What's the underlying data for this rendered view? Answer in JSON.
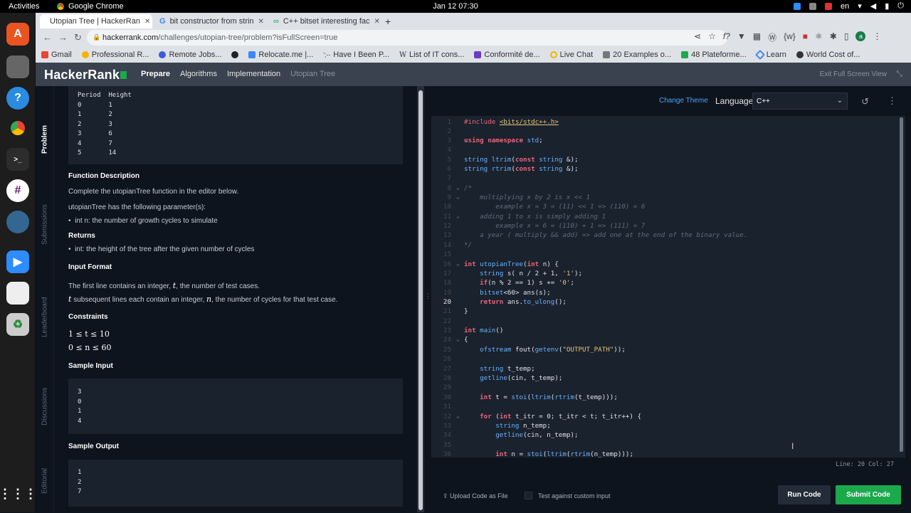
{
  "os": {
    "activities": "Activities",
    "app_name": "Google Chrome",
    "clock": "Jan 12  07:30",
    "lang": "en"
  },
  "browser": {
    "tabs": [
      {
        "label": "Utopian Tree | HackerRan"
      },
      {
        "label": "bit constructor from strin"
      },
      {
        "label": "C++ bitset interesting fac"
      }
    ],
    "url_host": "hackerrank.com",
    "url_path": "/challenges/utopian-tree/problem?isFullScreen=true",
    "bookmarks": [
      {
        "label": "Gmail",
        "color": "#ea4335"
      },
      {
        "label": "Professional R...",
        "color": "#f4b400"
      },
      {
        "label": "Remote Jobs...",
        "color": "#3b5bdb"
      },
      {
        "label": "",
        "color": "#222222"
      },
      {
        "label": "Relocate.me |...",
        "color": "#4285f4"
      },
      {
        "label": "Have I Been P...",
        "color": "#555555"
      },
      {
        "label": "List of IT cons...",
        "color": "#666666"
      },
      {
        "label": "Conformité de...",
        "color": "#6c3bc4"
      },
      {
        "label": "Live Chat",
        "color": "#f4b400"
      },
      {
        "label": "20 Examples o...",
        "color": "#777777"
      },
      {
        "label": "48 Plateforme...",
        "color": "#1ba94c"
      },
      {
        "label": "Learn",
        "color": "#4285f4"
      },
      {
        "label": "World Cost of...",
        "color": "#333333"
      }
    ]
  },
  "hr": {
    "logo": "HackerRank",
    "crumbs": [
      "Prepare",
      "Algorithms",
      "Implementation",
      "Utopian Tree"
    ],
    "exit_fullscreen": "Exit Full Screen View",
    "side_tabs": [
      "Problem",
      "Submissions",
      "Leaderboard",
      "Discussions",
      "Editorial"
    ]
  },
  "problem": {
    "table_header": "Period  Height",
    "table_rows": [
      "0       1",
      "1       2",
      "2       3",
      "3       6",
      "4       7",
      "5       14"
    ],
    "func_desc_h": "Function Description",
    "func_desc": "Complete the utopianTree function in the editor below.",
    "params_intro": "utopianTree has the following parameter(s):",
    "param_1": "int n: the number of growth cycles to simulate",
    "returns_h": "Returns",
    "returns_1": "int: the height of the tree after the given number of cycles",
    "input_h": "Input Format",
    "input_1_pre": "The first line contains an integer, ",
    "input_1_var": "t",
    "input_1_post": ", the number of test cases.",
    "input_2_var": "t",
    "input_2_mid": " subsequent lines each contain an integer, ",
    "input_2_var2": "n",
    "input_2_post": ", the number of cycles for that test case.",
    "constraints_h": "Constraints",
    "constraint_1": "1 ≤ t ≤ 10",
    "constraint_2": "0 ≤ n ≤ 60",
    "sample_in_h": "Sample Input",
    "sample_in": [
      "3",
      "0",
      "1",
      "4"
    ],
    "sample_out_h": "Sample Output",
    "sample_out": [
      "1",
      "2",
      "7"
    ]
  },
  "editor": {
    "change_theme": "Change Theme",
    "language_label": "Language",
    "language": "C++",
    "status": "Line: 20 Col: 27",
    "upload": "Upload Code as File",
    "custom_input": "Test against custom input",
    "run": "Run Code",
    "submit": "Submit Code"
  }
}
